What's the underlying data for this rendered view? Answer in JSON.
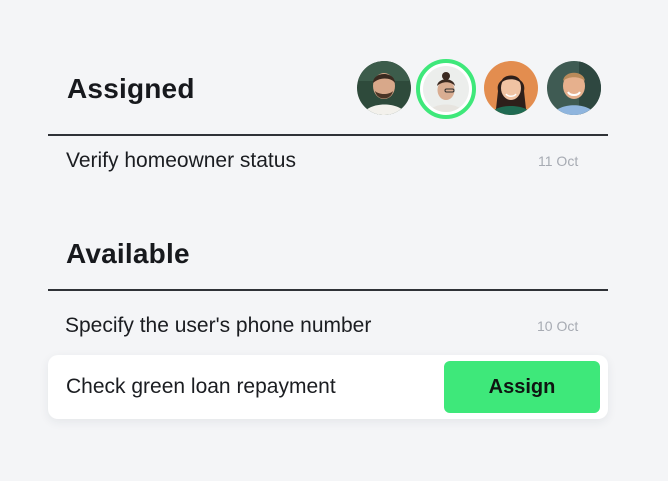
{
  "assigned": {
    "title": "Assigned",
    "avatars": [
      {
        "name": "avatar-man-beard-icon",
        "bg": "#2f4a3a"
      },
      {
        "name": "avatar-man-glasses-icon",
        "selected": true,
        "ring_color": "#3ee87a"
      },
      {
        "name": "avatar-woman-icon",
        "bg": "#e0894a"
      },
      {
        "name": "avatar-man-smiling-icon",
        "bg": "#3f5a52"
      }
    ],
    "tasks": [
      {
        "label": "Verify homeowner status",
        "date": "11 Oct"
      }
    ]
  },
  "available": {
    "title": "Available",
    "tasks": [
      {
        "label": "Specify the user's phone number",
        "date": "10 Oct"
      },
      {
        "label": "Check green loan repayment",
        "action_label": "Assign"
      }
    ]
  },
  "colors": {
    "accent": "#3ee87a",
    "background": "#f4f5f7",
    "date_text": "#a7abb3"
  }
}
